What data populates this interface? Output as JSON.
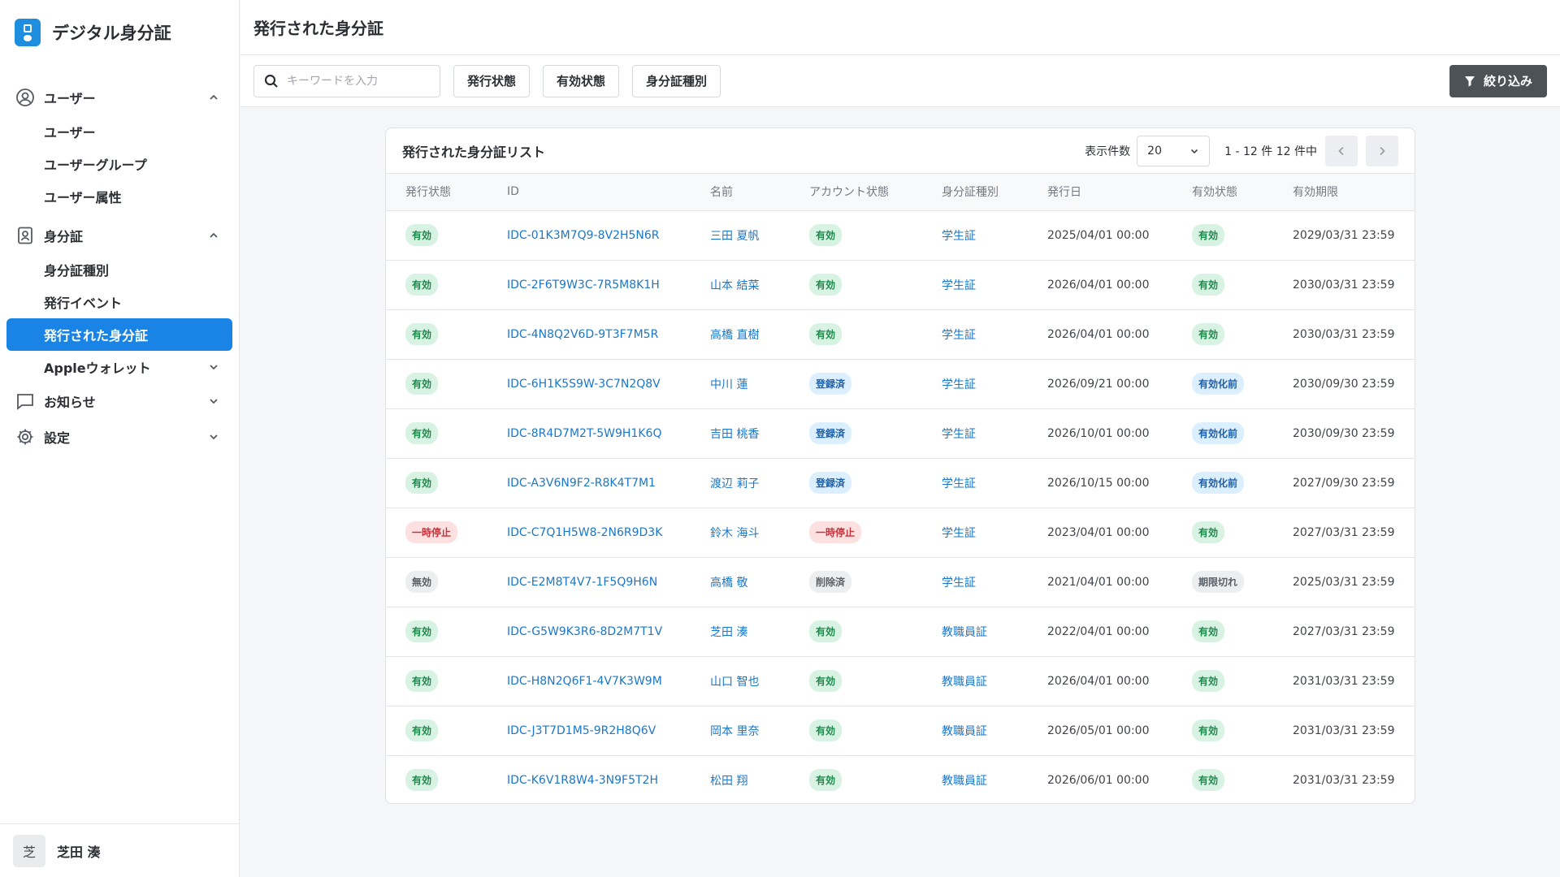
{
  "brand": {
    "title": "デジタル身分証"
  },
  "sidebar": {
    "groups": [
      {
        "label": "ユーザー",
        "items": [
          {
            "label": "ユーザー"
          },
          {
            "label": "ユーザーグループ"
          },
          {
            "label": "ユーザー属性"
          }
        ]
      },
      {
        "label": "身分証",
        "items": [
          {
            "label": "身分証種別"
          },
          {
            "label": "発行イベント"
          },
          {
            "label": "発行された身分証"
          },
          {
            "label": "Appleウォレット"
          }
        ]
      },
      {
        "label": "お知らせ"
      },
      {
        "label": "設定"
      }
    ],
    "active_item": "発行された身分証"
  },
  "user": {
    "avatar_char": "芝",
    "name": "芝田 湊"
  },
  "header": {
    "title": "発行された身分証"
  },
  "filters": {
    "search_placeholder": "キーワードを入力",
    "buttons": [
      "発行状態",
      "有効状態",
      "身分証種別"
    ],
    "narrow_label": "絞り込み"
  },
  "card": {
    "title": "発行された身分証リスト",
    "page_size_label": "表示件数",
    "page_size": "20",
    "range_text": "1 - 12 件 12 件中"
  },
  "table": {
    "columns": [
      "発行状態",
      "ID",
      "名前",
      "アカウント状態",
      "身分証種別",
      "発行日",
      "有効状態",
      "有効期限"
    ],
    "rows": [
      {
        "issue_status": "有効",
        "id": "IDC-01K3M7Q9-8V2H5N6R",
        "name": "三田 夏帆",
        "account_status": "有効",
        "type": "学生証",
        "issued": "2025/04/01 00:00",
        "valid_status": "有効",
        "expires": "2029/03/31 23:59"
      },
      {
        "issue_status": "有効",
        "id": "IDC-2F6T9W3C-7R5M8K1H",
        "name": "山本 結菜",
        "account_status": "有効",
        "type": "学生証",
        "issued": "2026/04/01 00:00",
        "valid_status": "有効",
        "expires": "2030/03/31 23:59"
      },
      {
        "issue_status": "有効",
        "id": "IDC-4N8Q2V6D-9T3F7M5R",
        "name": "高橋 直樹",
        "account_status": "有効",
        "type": "学生証",
        "issued": "2026/04/01 00:00",
        "valid_status": "有効",
        "expires": "2030/03/31 23:59"
      },
      {
        "issue_status": "有効",
        "id": "IDC-6H1K5S9W-3C7N2Q8V",
        "name": "中川 蓮",
        "account_status": "登録済",
        "type": "学生証",
        "issued": "2026/09/21 00:00",
        "valid_status": "有効化前",
        "expires": "2030/09/30 23:59"
      },
      {
        "issue_status": "有効",
        "id": "IDC-8R4D7M2T-5W9H1K6Q",
        "name": "吉田 桃香",
        "account_status": "登録済",
        "type": "学生証",
        "issued": "2026/10/01 00:00",
        "valid_status": "有効化前",
        "expires": "2030/09/30 23:59"
      },
      {
        "issue_status": "有効",
        "id": "IDC-A3V6N9F2-R8K4T7M1",
        "name": "渡辺 莉子",
        "account_status": "登録済",
        "type": "学生証",
        "issued": "2026/10/15 00:00",
        "valid_status": "有効化前",
        "expires": "2027/09/30 23:59"
      },
      {
        "issue_status": "一時停止",
        "id": "IDC-C7Q1H5W8-2N6R9D3K",
        "name": "鈴木 海斗",
        "account_status": "一時停止",
        "type": "学生証",
        "issued": "2023/04/01 00:00",
        "valid_status": "有効",
        "expires": "2027/03/31 23:59"
      },
      {
        "issue_status": "無効",
        "id": "IDC-E2M8T4V7-1F5Q9H6N",
        "name": "高橋 敬",
        "account_status": "削除済",
        "type": "学生証",
        "issued": "2021/04/01 00:00",
        "valid_status": "期限切れ",
        "expires": "2025/03/31 23:59"
      },
      {
        "issue_status": "有効",
        "id": "IDC-G5W9K3R6-8D2M7T1V",
        "name": "芝田 湊",
        "account_status": "有効",
        "type": "教職員証",
        "issued": "2022/04/01 00:00",
        "valid_status": "有効",
        "expires": "2027/03/31 23:59"
      },
      {
        "issue_status": "有効",
        "id": "IDC-H8N2Q6F1-4V7K3W9M",
        "name": "山口 智也",
        "account_status": "有効",
        "type": "教職員証",
        "issued": "2026/04/01 00:00",
        "valid_status": "有効",
        "expires": "2031/03/31 23:59"
      },
      {
        "issue_status": "有効",
        "id": "IDC-J3T7D1M5-9R2H8Q6V",
        "name": "岡本 里奈",
        "account_status": "有効",
        "type": "教職員証",
        "issued": "2026/05/01 00:00",
        "valid_status": "有効",
        "expires": "2031/03/31 23:59"
      },
      {
        "issue_status": "有効",
        "id": "IDC-K6V1R8W4-3N9F5T2H",
        "name": "松田 翔",
        "account_status": "有効",
        "type": "教職員証",
        "issued": "2026/06/01 00:00",
        "valid_status": "有効",
        "expires": "2031/03/31 23:59"
      }
    ]
  },
  "status_colors": {
    "有効": "green",
    "登録済": "blue",
    "有効化前": "blue",
    "一時停止": "red",
    "無効": "gray",
    "削除済": "gray",
    "期限切れ": "gray"
  },
  "colors": {
    "accent": "#1a84e6",
    "link": "#1a77c9",
    "dark_button": "#4d5257"
  }
}
